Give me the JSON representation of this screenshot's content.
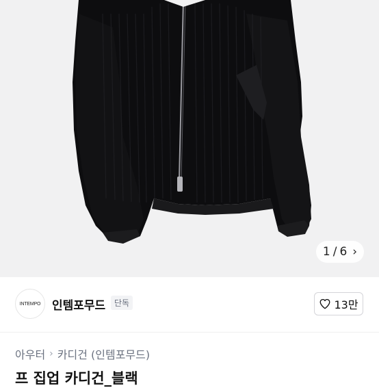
{
  "product_image": {
    "alt_icon": "black-zip-cardigan-photo",
    "counter": {
      "current": "1",
      "separator": "/",
      "total": "6"
    },
    "background_color": "#f1f1f2"
  },
  "seller": {
    "logo_text": "INTEMPO",
    "name": "인템포무드",
    "badge": "단독"
  },
  "like": {
    "icon": "heart-icon",
    "count": "13만"
  },
  "breadcrumb": [
    {
      "label": "아우터"
    },
    {
      "label": "카디건 (인템포무드)"
    }
  ],
  "product": {
    "title": "프 집업 카디건_블랙"
  }
}
